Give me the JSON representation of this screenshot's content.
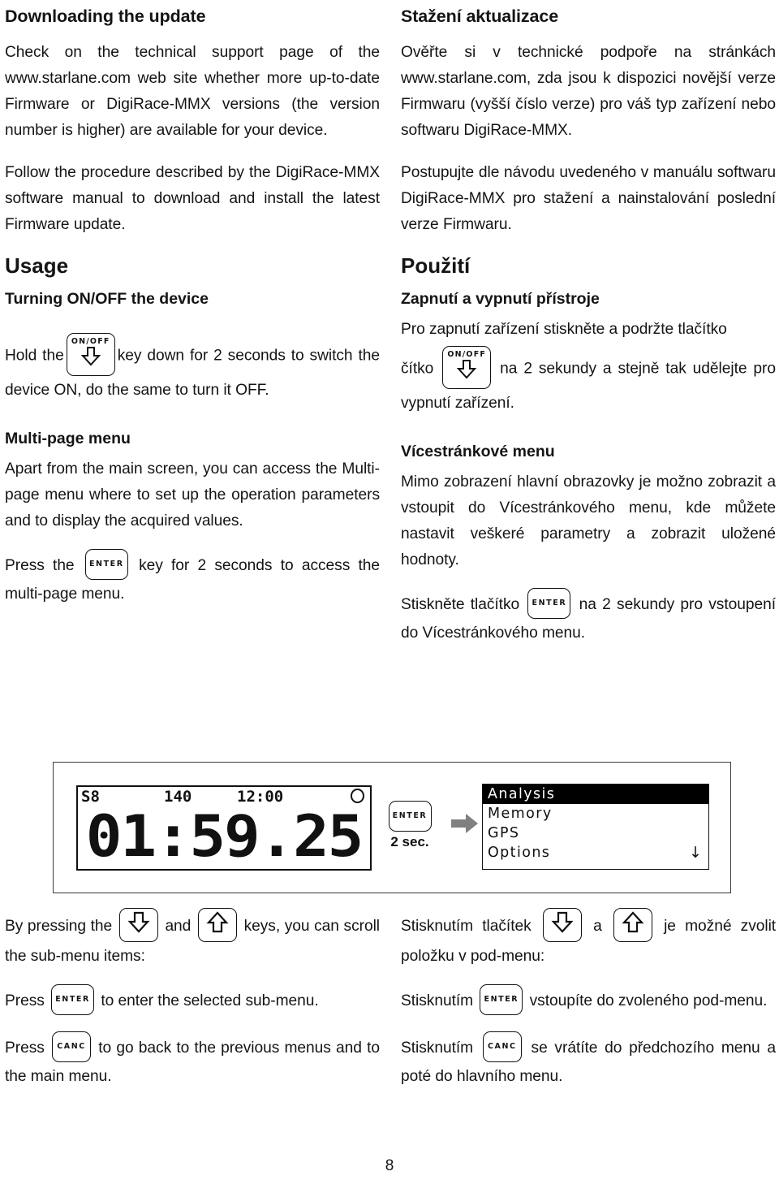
{
  "page": {
    "number": "8"
  },
  "left": {
    "heading_download": "Downloading the update",
    "p_check": "Check on the technical support page of the www.starlane.com web site whether more up-to-date Firmware or DigiRace-MMX versions (the version number is higher) are available for your device.",
    "p_follow": "Follow the procedure described by the DigiRace-MMX software manual to download and install the latest Firmware update.",
    "heading_usage": "Usage",
    "heading_turning": "Turning ON/OFF the device",
    "p_hold_a": "Hold the",
    "p_hold_b": "key down for 2 seconds to switch the device ON, do the same to turn it OFF.",
    "heading_multipage": "Multi-page menu",
    "p_apart": "Apart from the main screen, you can access the Multi-page menu where to set up the operation parameters and to display the acquired values.",
    "p_press_a": "Press the",
    "p_press_b": "key for 2 seconds to access the multi-page menu.",
    "p_scroll_a": "By pressing the",
    "p_scroll_b": "and",
    "p_scroll_c": "keys, you can scroll the sub-menu items:",
    "p_enter_a": "Press",
    "p_enter_b": "to enter the selected sub-menu.",
    "p_canc_a": "Press",
    "p_canc_b": "to go back to the previous menus and to the main menu."
  },
  "right": {
    "heading_download": "Stažení aktualizace",
    "p_check": "Ověřte si v technické podpoře na stránkách www.starlane.com, zda jsou k dispozici novější verze Firmwaru (vyšší číslo verze) pro váš typ zařízení nebo softwaru  DigiRace-MMX.",
    "p_follow": "Postupujte dle návodu uvedeného v manuálu softwaru DigiRace-MMX pro stažení a nainstalování poslední verze Firmwaru.",
    "heading_usage": "Použití",
    "heading_turning": "Zapnutí a vypnutí přístroje",
    "p_hold_pre": "Pro zapnutí zařízení stiskněte a podržte tlačítko",
    "p_hold_a": "čítko",
    "p_hold_b": "na 2 sekundy a stejně tak udělejte pro vypnutí zařízení.",
    "heading_multipage": "Vícestránkové  menu",
    "p_apart": "Mimo zobrazení hlavní obrazovky je možno zobrazit a vstoupit do Vícestránkového menu, kde můžete nastavit veškeré  parametry a zobrazit uložené hodnoty.",
    "p_press_a": "Stiskněte tlačítko",
    "p_press_b": "na 2 sekundy pro vstoupení do Vícestránkového menu.",
    "p_scroll_a": "Stisknutím tlačítek",
    "p_scroll_b": "a",
    "p_scroll_c": "je možné zvolit položku v pod-menu:",
    "p_enter_a": "Stisknutím",
    "p_enter_b": "vstoupíte do zvoleného pod-menu.",
    "p_canc_a": "Stisknutím",
    "p_canc_b": "se vrátíte do předchozího menu a poté do hlavního menu."
  },
  "keys": {
    "onoff_label": "ON/OFF",
    "enter_label": "ENTER",
    "canc_label": "CANC"
  },
  "figure": {
    "lcd": {
      "satellites": "S8",
      "rpm": "140",
      "clock": "12:00",
      "laptime": "01:59.25"
    },
    "transition_key": "ENTER",
    "transition_duration": "2 sec.",
    "menu_items": [
      {
        "label": "Analysis",
        "selected": true
      },
      {
        "label": "Memory",
        "selected": false
      },
      {
        "label": "GPS",
        "selected": false
      },
      {
        "label": "Options",
        "selected": false
      }
    ],
    "scroll_indicator": "↓"
  }
}
